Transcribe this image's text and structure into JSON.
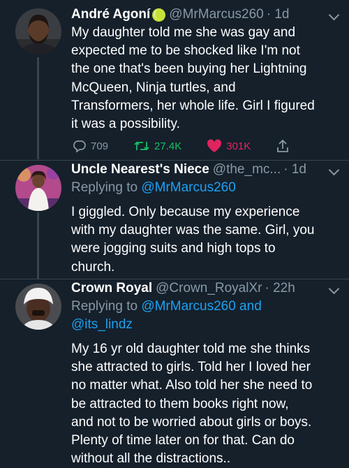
{
  "tweets": [
    {
      "name": "André Agoní",
      "handle": "@MrMarcus260",
      "time": "· 1d",
      "body_lines": [
        "My daughter told me she was gay and",
        "expected me to be shocked like I'm not",
        "the one that's been buying her Lightning",
        "McQueen, Ninja turtles, and",
        "Transformers, her whole life. Girl I figured",
        "it was a possibility."
      ],
      "replies": "709",
      "retweets": "27.4K",
      "likes": "301K"
    },
    {
      "name": "Uncle Nearest's Niece",
      "handle": "@the_mc...",
      "time": "· 1d",
      "replying_prefix": "Replying to ",
      "replying_to": "@MrMarcus260",
      "body_lines": [
        "I giggled. Only because my experience",
        "with my daughter was the same. Girl, you",
        "were jogging suits and high tops to",
        "church."
      ]
    },
    {
      "name": "Crown Royal",
      "handle": "@Crown_RoyalXr",
      "time": "· 22h",
      "replying_prefix": "Replying to ",
      "replying_to": "@MrMarcus260",
      "replying_and": " and",
      "replying_to_2": "@its_lindz",
      "body_lines": [
        "My 16 yr old daughter told me she thinks",
        "she attracted to girls. Told her I loved her",
        "no matter what. Also told her she need to",
        "be attracted to them books right now,",
        "and not to be worried about girls or boys.",
        "Plenty of time later on for that. Can do",
        "without all the distractions.."
      ]
    }
  ],
  "colors": {
    "background": "#15202b",
    "secondary_text": "#8899a6",
    "link": "#1da1f2",
    "retweet": "#17bf63",
    "like": "#e0245e"
  },
  "icons": [
    "reply-icon",
    "retweet-icon",
    "heart-icon",
    "share-icon",
    "chevron-down-icon",
    "tennis-ball-emoji"
  ]
}
